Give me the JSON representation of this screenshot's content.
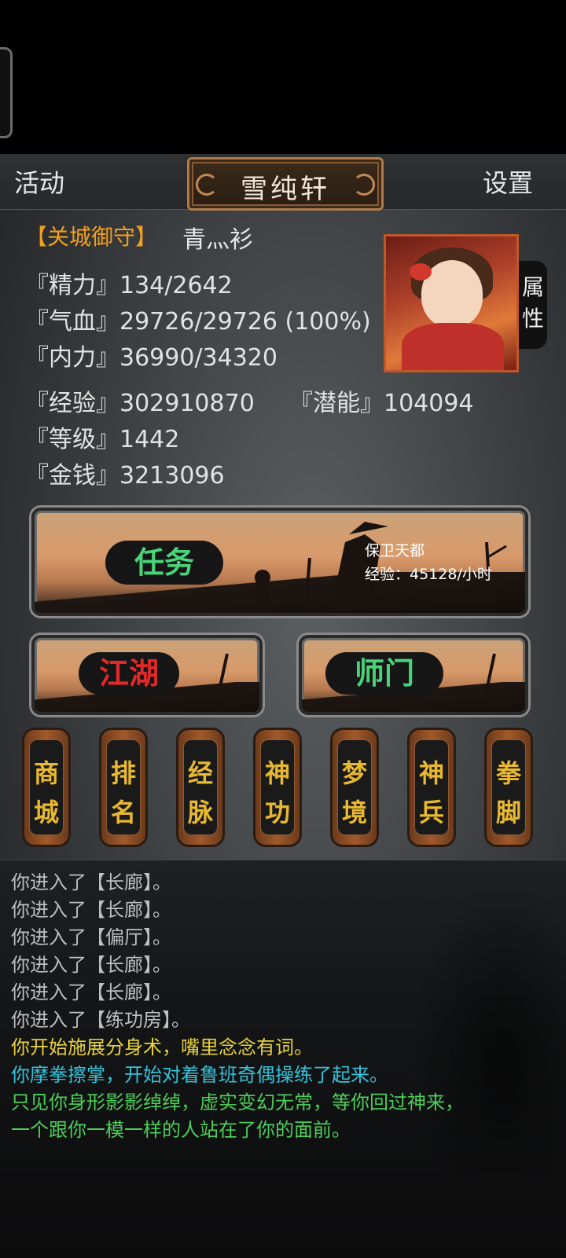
{
  "header": {
    "left": "活动",
    "title": "雪纯轩",
    "right": "设置"
  },
  "player": {
    "title": "【关城御守】",
    "name": "青灬衫"
  },
  "stats": {
    "jingli": "『精力』134/2642",
    "qixue": "『气血』29726/29726 (100%)",
    "neili": "『内力』36990/34320",
    "jingyan": "『经验』302910870",
    "qianneng": "『潜能』104094",
    "dengji": "『等级』1442",
    "jinqian": "『金钱』3213096"
  },
  "attr_tab": [
    "属",
    "性"
  ],
  "task": {
    "label": "任务",
    "name": "保卫天都",
    "exp": "经验：45128/小时"
  },
  "buttons": {
    "jianghu": "江湖",
    "shimen": "师门"
  },
  "pillars": [
    [
      "商",
      "城"
    ],
    [
      "排",
      "名"
    ],
    [
      "经",
      "脉"
    ],
    [
      "神",
      "功"
    ],
    [
      "梦",
      "境"
    ],
    [
      "神",
      "兵"
    ],
    [
      "拳",
      "脚"
    ]
  ],
  "log": [
    {
      "text": "你进入了【长廊】。",
      "color": "#bfbfbf"
    },
    {
      "text": "你进入了【长廊】。",
      "color": "#bfbfbf"
    },
    {
      "text": "你进入了【偏厅】。",
      "color": "#bfbfbf"
    },
    {
      "text": "你进入了【长廊】。",
      "color": "#bfbfbf"
    },
    {
      "text": "你进入了【长廊】。",
      "color": "#bfbfbf"
    },
    {
      "text": "你进入了【练功房】。",
      "color": "#bfbfbf"
    },
    {
      "text": "你开始施展分身术，嘴里念念有词。",
      "color": "#e8d23a"
    },
    {
      "text": "你摩拳擦掌，开始对着鲁班奇偶操练了起来。",
      "color": "#36c2d8"
    },
    {
      "text": "只见你身形影影绰绰，虚实变幻无常，等你回过神来，",
      "color": "#4ccf5a"
    },
    {
      "text": "一个跟你一模一样的人站在了你的面前。",
      "color": "#4ccf5a"
    }
  ]
}
